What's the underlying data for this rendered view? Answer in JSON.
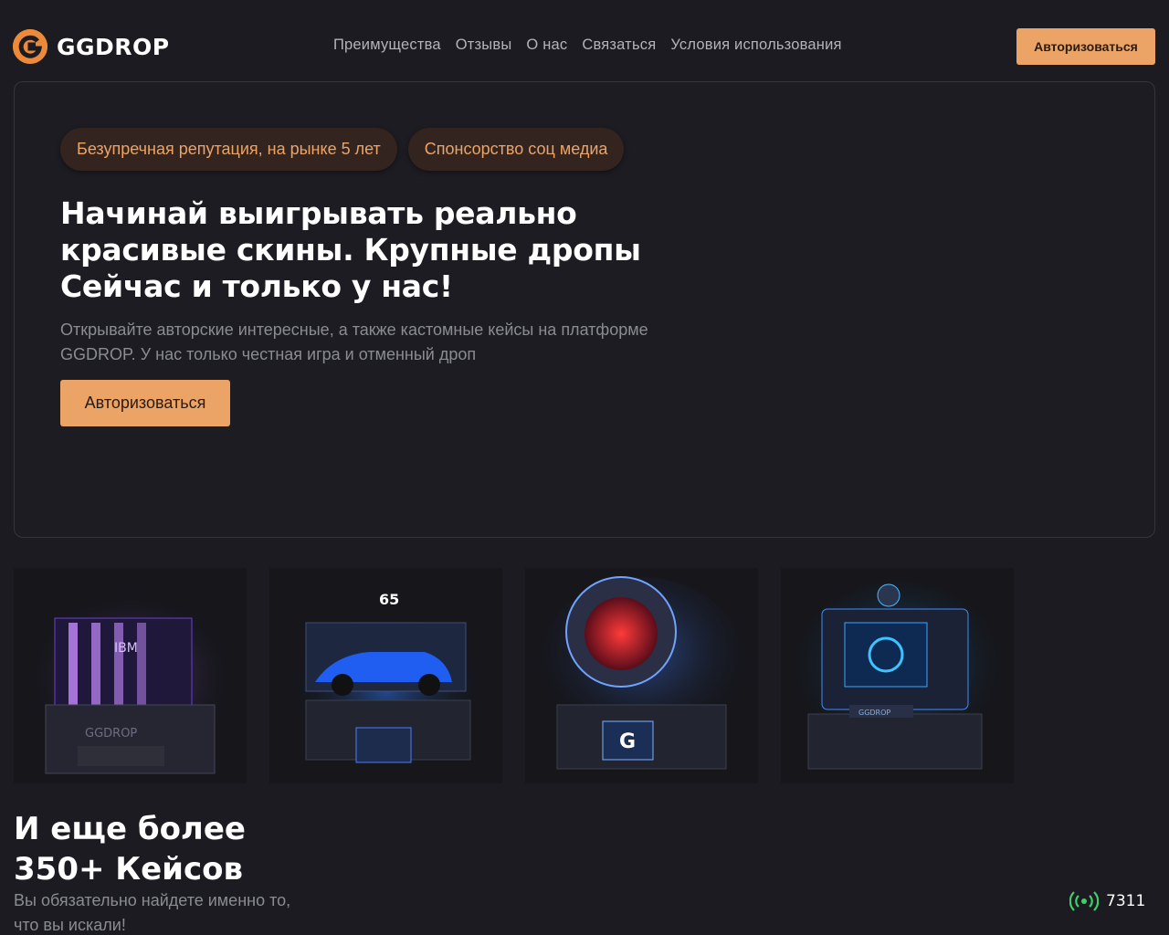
{
  "brand": {
    "name": "GGDROP"
  },
  "nav": {
    "items": [
      "Преимущества",
      "Отзывы",
      "О нас",
      "Связаться",
      "Условия использования"
    ]
  },
  "header": {
    "login_label": "Авторизоваться"
  },
  "hero": {
    "pills": [
      "Безупречная репутация, на рынке 5 лет",
      "Спонсорство соц медиа"
    ],
    "title_lines": [
      "Начинай выигрывать реально",
      "красивые скины. Крупные дропы",
      "Сейчас и только у нас!"
    ],
    "subtitle_lines": [
      "Открывайте авторские интересные, а также кастомные кейсы на платформе",
      "GGDROP. У нас только честная игра и отменный дроп"
    ],
    "login_label": "Авторизоваться"
  },
  "cases": [
    {
      "name": "case-ibm",
      "accent": "#a24dff",
      "labels": [
        "IBM",
        "GGDROP"
      ]
    },
    {
      "name": "case-car",
      "accent": "#2f7bff",
      "labels": [
        "65"
      ]
    },
    {
      "name": "case-helmet",
      "accent": "#4a8cff",
      "labels": []
    },
    {
      "name": "case-ai",
      "accent": "#1fa7ff",
      "labels": [
        "GGDROP"
      ]
    }
  ],
  "more": {
    "title_lines": [
      "И еще более",
      "350+ Кейсов"
    ],
    "subtitle_lines": [
      "Вы обязательно найдете именно то,",
      "что вы искали!"
    ]
  },
  "online": {
    "icon": "broadcast-icon",
    "count": "7311",
    "color": "#3ecf6a"
  },
  "colors": {
    "accent": "#eca466",
    "background": "#1b1b21",
    "pill_bg": "#33241f"
  }
}
